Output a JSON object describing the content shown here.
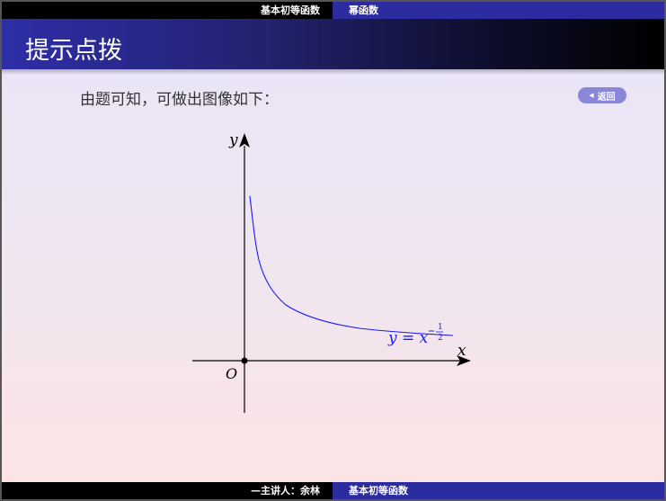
{
  "header": {
    "section": "基本初等函数",
    "subsection": "幂函数"
  },
  "slide": {
    "title": "提示点拨",
    "text": "由题可知，可做出图像如下：",
    "back_label": "返回"
  },
  "graph": {
    "y_label": "y",
    "x_label": "x",
    "origin_label": "O",
    "curve_label_lhs": "y = x",
    "exponent_num": "1",
    "exponent_den": "2",
    "curve_color": "#1a1aff"
  },
  "footer": {
    "presenter": "—主讲人：余林",
    "course": "基本初等函数"
  }
}
